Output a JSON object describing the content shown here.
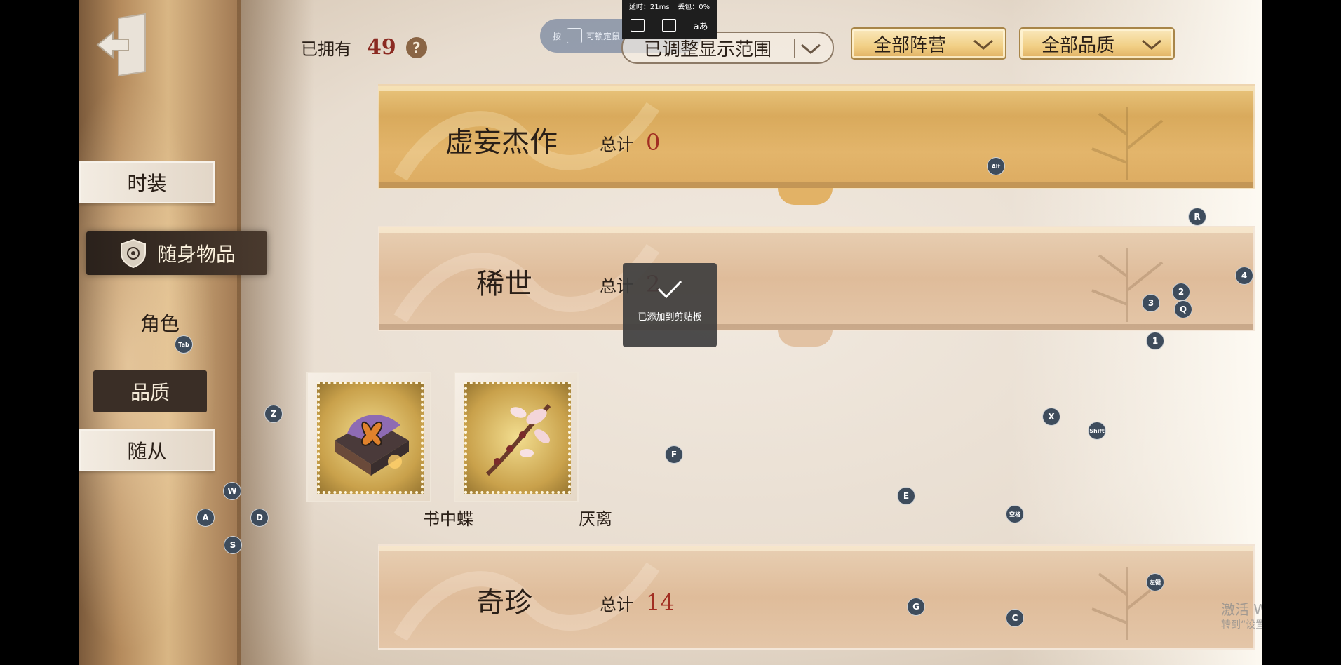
{
  "recorder": {
    "latency": "延时：21ms",
    "loss": "丢包：0%",
    "translate_label": "aあ"
  },
  "header": {
    "owned_label": "已拥有",
    "owned_count": "49",
    "help_label": "?",
    "hint_prefix": "按",
    "hint_text": "可锁定鼠",
    "range_dropdown": "已调整显示范围",
    "camp_dropdown": "全部阵营",
    "quality_dropdown": "全部品质"
  },
  "sidebar": {
    "items": [
      {
        "label": "时装",
        "state": "frame"
      },
      {
        "label": "随身物品",
        "state": "active"
      },
      {
        "label": "角色",
        "state": "plain"
      },
      {
        "label": "品质",
        "state": "dark"
      },
      {
        "label": "随从",
        "state": "frame"
      }
    ]
  },
  "sections": [
    {
      "title": "虚妄杰作",
      "total_label": "总计",
      "total": "0",
      "style": "gold"
    },
    {
      "title": "稀世",
      "total_label": "总计",
      "total": "2",
      "style": "rose"
    },
    {
      "title": "奇珍",
      "total_label": "总计",
      "total": "14",
      "style": "rose"
    }
  ],
  "items": [
    {
      "name": "书中蝶",
      "icon": "butterfly-book-icon"
    },
    {
      "name": "厌离",
      "icon": "blossom-branch-icon"
    }
  ],
  "toast": {
    "message": "已添加到剪贴板"
  },
  "key_hints": {
    "alt": "Alt",
    "r": "R",
    "four": "4",
    "two": "2",
    "three": "3",
    "q": "Q",
    "one": "1",
    "tab": "Tab",
    "z": "Z",
    "x": "X",
    "shift": "Shift",
    "f": "F",
    "w": "W",
    "a": "A",
    "d": "D",
    "s": "S",
    "e": "E",
    "space": "空格",
    "left_click": "左键",
    "g": "G",
    "c": "C"
  },
  "watermark": {
    "line1": "激活 Windows",
    "line2": "转到“设置”以激活 Windows。"
  },
  "colors": {
    "gold": "#e3b56b",
    "rose": "#e2c2a3",
    "count_red": "#a22e22",
    "key_bg": "#3e4c5c"
  }
}
